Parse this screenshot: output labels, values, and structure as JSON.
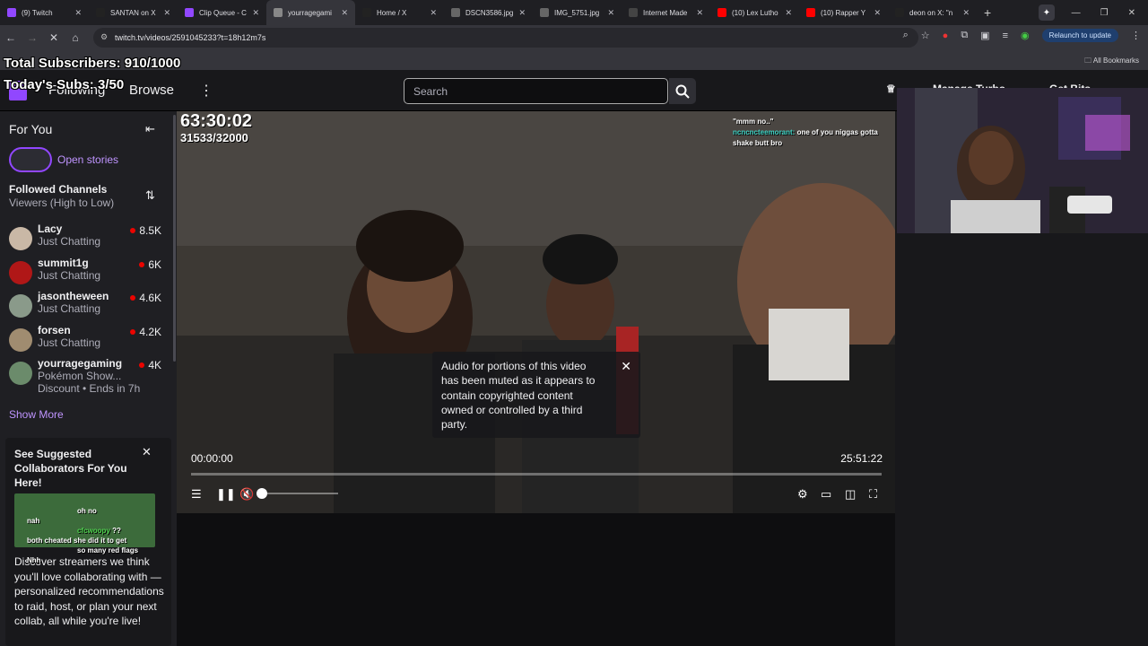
{
  "browser": {
    "tabs": [
      {
        "title": "(9) Twitch",
        "color": "#9147ff"
      },
      {
        "title": "SANTAN on X",
        "color": "#222222"
      },
      {
        "title": "Clip Queue - C",
        "color": "#9147ff"
      },
      {
        "title": "yourragegami",
        "color": "#888888",
        "active": true
      },
      {
        "title": "Home / X",
        "color": "#222222"
      },
      {
        "title": "DSCN3586.jpg",
        "color": "#666666"
      },
      {
        "title": "IMG_5751.jpg",
        "color": "#666666"
      },
      {
        "title": "Internet Made",
        "color": "#444444"
      },
      {
        "title": "(10) Lex Lutho",
        "color": "#ff0000"
      },
      {
        "title": "(10) Rapper Y",
        "color": "#ff0000"
      },
      {
        "title": "deon on X: \"n",
        "color": "#222222"
      }
    ],
    "new_tab_label": "+",
    "url": "twitch.tv/videos/2591045233?t=18h12m7s",
    "relaunch_label": "Relaunch to update",
    "all_bookmarks_label": "All Bookmarks"
  },
  "stream_overlay": {
    "total_subs": "Total Subscribers: 910/1000",
    "todays_subs": "Today's Subs: 3/50"
  },
  "twitch_header": {
    "following": "Following",
    "browse": "Browse",
    "search_placeholder": "Search",
    "manage_turbo": "Manage Turbo",
    "get_bits": "Get Bits"
  },
  "sidebar": {
    "heading": "For You",
    "stories_label": "Open stories",
    "followed_title": "Followed Channels",
    "followed_sort": "Viewers (High to Low)",
    "channels": [
      {
        "name": "Lacy",
        "game": "Just Chatting",
        "viewers": "8.5K",
        "color": "#c9b8a6"
      },
      {
        "name": "summit1g",
        "game": "Just Chatting",
        "viewers": "6K",
        "color": "#b01717"
      },
      {
        "name": "jasontheween",
        "game": "Just Chatting",
        "viewers": "4.6K",
        "color": "#8a9a8a"
      },
      {
        "name": "forsen",
        "game": "Just Chatting",
        "viewers": "4.2K",
        "color": "#a08c70"
      },
      {
        "name": "yourragegaming",
        "game": "Pokémon Show...",
        "viewers": "4K",
        "color": "#6b8b6b",
        "extra": "Discount • Ends in 7h"
      }
    ],
    "show_more": "Show More",
    "collab": {
      "heading": "See Suggested Collaborators For You Here!",
      "description": "Discover streamers we think you'll love collaborating with — personalized recommendations to raid, host, or plan your next collab, all while you're live!"
    }
  },
  "player": {
    "clock": "63:30:02",
    "subs": "31533/32000",
    "overlay_chat": [
      {
        "user": "",
        "text": "\"mmm no..\""
      },
      {
        "user": "ncncncteemorant:",
        "text": "one of you niggas gotta shake butt bro"
      }
    ],
    "muted_notice": "Audio for portions of this video has been muted as it appears to contain copyrighted content owned or controlled by a third party.",
    "current_time": "00:00:00",
    "duration": "25:51:22",
    "volume_level": 0
  },
  "bottom_chat": [
    {
      "user": "",
      "text": "oh no"
    },
    {
      "user": "",
      "text": "nah"
    },
    {
      "user": "cfcwoopy",
      "text": "??"
    },
    {
      "user": "",
      "text": "both cheated she did it to get"
    },
    {
      "user": "",
      "text": "so many red flags"
    },
    {
      "user": "",
      "text": "Nhh"
    }
  ],
  "colors": {
    "accent": "#9147ff",
    "live": "#eb0400",
    "link": "#bf94ff"
  }
}
